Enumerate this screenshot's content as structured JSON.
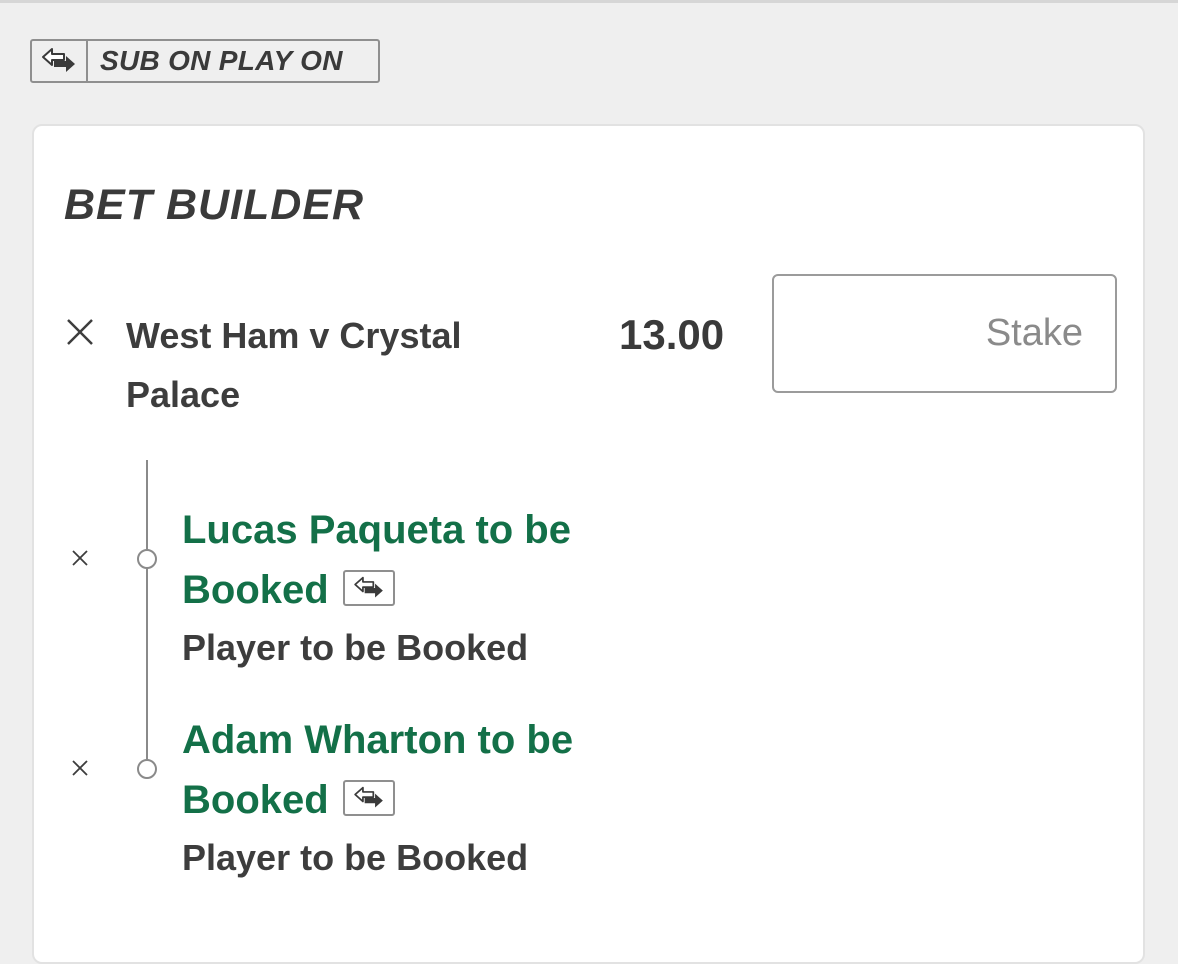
{
  "badge": {
    "label": "SUB ON PLAY ON",
    "icon": "swap-arrows-icon"
  },
  "bet_builder": {
    "title": "BET BUILDER",
    "match": "West Ham v Crystal Palace",
    "odds": "13.00",
    "stake_placeholder": "Stake",
    "stake_value": "",
    "selections": [
      {
        "name": "Lucas Paqueta to be Booked",
        "market": "Player to be Booked",
        "icon": "swap-arrows-icon"
      },
      {
        "name": "Adam Wharton to be Booked",
        "market": "Player to be Booked",
        "icon": "swap-arrows-icon"
      }
    ]
  },
  "colors": {
    "background": "#efefef",
    "card": "#ffffff",
    "selection_text": "#137048",
    "text": "#3d3d3d",
    "border": "#8f8f8f"
  }
}
